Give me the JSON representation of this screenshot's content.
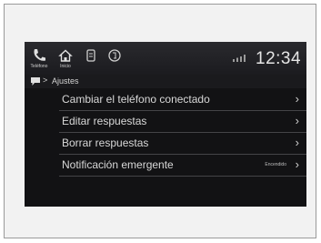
{
  "status_bar": {
    "time": "12:34",
    "icons": [
      {
        "name": "phone-icon",
        "label": "Teléfono"
      },
      {
        "name": "home-icon",
        "label": "Inicio"
      },
      {
        "name": "apps-icon",
        "label": ""
      },
      {
        "name": "notification-icon",
        "label": ""
      }
    ]
  },
  "breadcrumb": {
    "icon": "chat-bubble-icon",
    "label": "Ajustes"
  },
  "menu": {
    "items": [
      {
        "label": "Cambiar el teléfono conectado",
        "status": ""
      },
      {
        "label": "Editar respuestas",
        "status": ""
      },
      {
        "label": "Borrar respuestas",
        "status": ""
      },
      {
        "label": "Notificación emergente",
        "status": "Encendido"
      }
    ]
  }
}
